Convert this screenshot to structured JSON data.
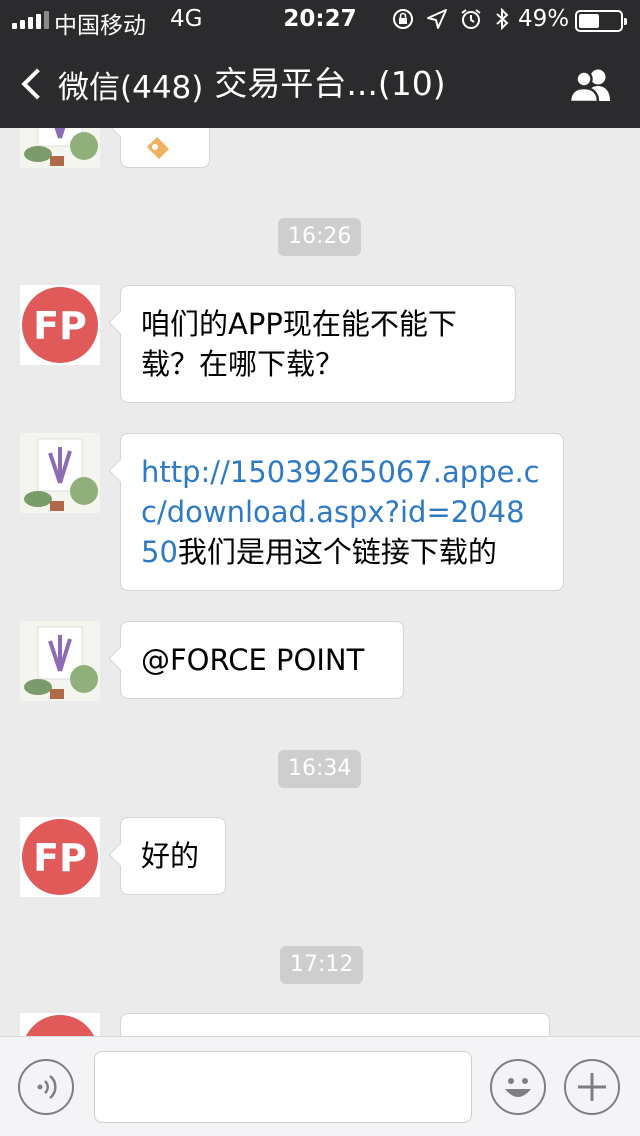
{
  "status_bar": {
    "carrier": "中国移动",
    "network": "4G",
    "time": "20:27",
    "battery_percent": "49%",
    "battery_level": 0.49
  },
  "nav": {
    "back_label": "微信(448)",
    "title": "交易平台...(10)"
  },
  "chat": {
    "timestamps": [
      "16:26",
      "16:34",
      "17:12"
    ],
    "messages": [
      {
        "text": "咱们的APP现在能不能下载？在哪下载？"
      },
      {
        "link": "http://15039265067.appe.cc/download.aspx?id=204850",
        "text": "我们是用这个链接下载的"
      },
      {
        "text": "@FORCE POINT"
      },
      {
        "text": "好的"
      }
    ]
  },
  "input": {
    "value": ""
  },
  "colors": {
    "bar_bg": "#2b2b2e",
    "chat_bg": "#ebebeb",
    "link": "#2e7bc4",
    "fp_logo": "#e05a5a"
  }
}
